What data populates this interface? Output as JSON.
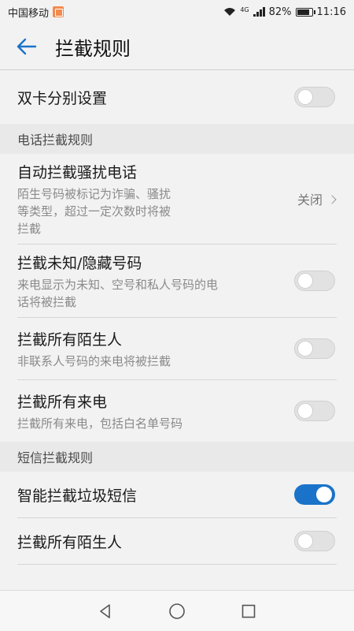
{
  "status_bar": {
    "carrier": "中国移动",
    "network": "4G",
    "battery": "82%",
    "time": "11:16"
  },
  "app_bar": {
    "title": "拦截规则"
  },
  "dual_sim": {
    "label": "双卡分别设置",
    "toggle_on": false
  },
  "call_section": {
    "header": "电话拦截规则",
    "items": [
      {
        "label": "自动拦截骚扰电话",
        "sub_lines": [
          "陌生号码被标记为诈骗、骚扰",
          "等类型，超过一定次数时将被",
          "拦截"
        ],
        "value": "关闭"
      },
      {
        "label": "拦截未知/隐藏号码",
        "sub_lines": [
          "来电显示为未知、空号和私人号码的电",
          "话将被拦截"
        ],
        "toggle_on": false
      },
      {
        "label": "拦截所有陌生人",
        "sub_lines": [
          "非联系人号码的来电将被拦截"
        ],
        "toggle_on": false
      },
      {
        "label": "拦截所有来电",
        "sub_lines": [
          "拦截所有来电，包括白名单号码"
        ],
        "toggle_on": false
      }
    ]
  },
  "sms_section": {
    "header": "短信拦截规则",
    "items": [
      {
        "label": "智能拦截垃圾短信",
        "toggle_on": true
      },
      {
        "label": "拦截所有陌生人",
        "toggle_on": false
      }
    ]
  },
  "colors": {
    "accent": "#1a73c8",
    "background": "#f2f2f2"
  }
}
